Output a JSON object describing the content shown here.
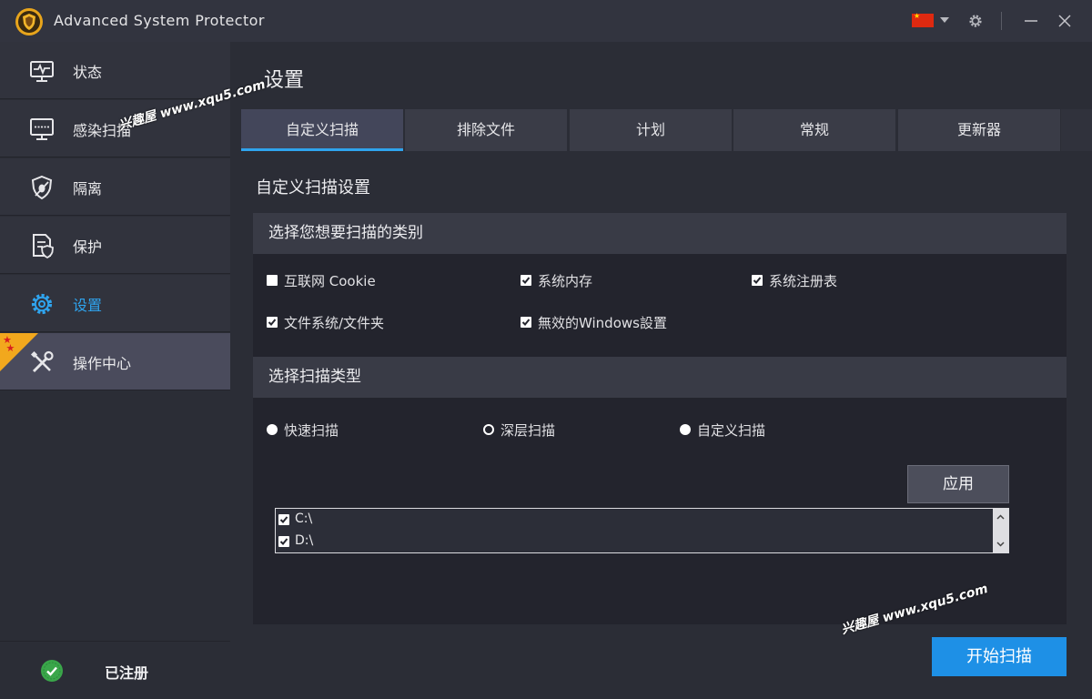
{
  "window": {
    "title": "Advanced System Protector"
  },
  "sidebar": {
    "items": [
      {
        "label": "状态",
        "icon": "monitor-pulse-icon"
      },
      {
        "label": "感染扫描",
        "icon": "scan-monitor-icon"
      },
      {
        "label": "隔离",
        "icon": "shield-bug-icon"
      },
      {
        "label": "保护",
        "icon": "document-shield-icon"
      },
      {
        "label": "设置",
        "icon": "gear-icon"
      },
      {
        "label": "操作中心",
        "icon": "tools-icon"
      }
    ],
    "selected_index": 4,
    "registered_label": "已注册"
  },
  "main": {
    "page_title": "设置",
    "tabs": [
      {
        "label": "自定义扫描"
      },
      {
        "label": "排除文件"
      },
      {
        "label": "计划"
      },
      {
        "label": "常规"
      },
      {
        "label": "更新器"
      }
    ],
    "section_title": "自定义扫描设置",
    "categories": {
      "header": "选择您想要扫描的类别",
      "items": [
        {
          "label": "互联网 Cookie",
          "checked": false
        },
        {
          "label": "系统内存",
          "checked": true
        },
        {
          "label": "系统注册表",
          "checked": true
        },
        {
          "label": "文件系统/文件夹",
          "checked": true
        },
        {
          "label": "無效的Windows設置",
          "checked": true
        }
      ]
    },
    "scan_type": {
      "header": "选择扫描类型",
      "options": [
        {
          "label": "快速扫描",
          "selected": false
        },
        {
          "label": "深层扫描",
          "selected": true
        },
        {
          "label": "自定义扫描",
          "selected": false
        }
      ]
    },
    "apply_label": "应用",
    "drives": [
      {
        "label": "C:\\",
        "checked": true
      },
      {
        "label": "D:\\",
        "checked": true
      }
    ],
    "start_scan_label": "开始扫描"
  },
  "watermarks": [
    "兴趣屋 www.xqu5.com",
    "兴趣屋 www.xqu5.com"
  ],
  "colors": {
    "accent": "#2fa4ee",
    "start_button": "#1e90e6",
    "badge": "#f2a81d",
    "flag": "#de2910"
  }
}
